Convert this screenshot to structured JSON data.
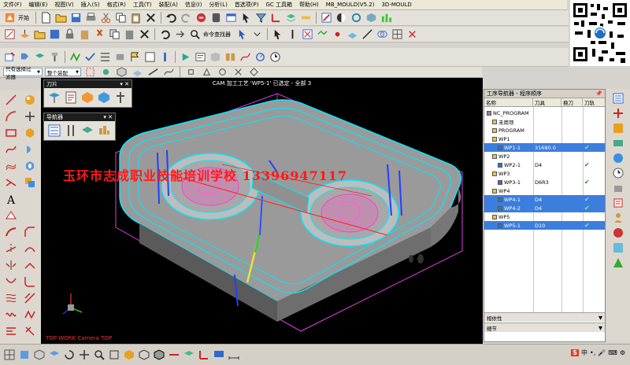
{
  "menu": [
    "文件(F)",
    "编辑(E)",
    "视图(V)",
    "插入(S)",
    "格式(R)",
    "工具(T)",
    "装配(A)",
    "信息(I)",
    "分析(L)",
    "首选项(P)",
    "GC 工具箱",
    "帮助(H)",
    "MB_MOULD(V5.2)",
    "3D-MOULD"
  ],
  "toolbar1": {
    "start_label": "开始"
  },
  "toolbar2": {
    "cmd_finder_label": "命令查找器"
  },
  "selection": {
    "filter_value": "只有选择过滤器",
    "assembly_value": "整个装配"
  },
  "camera_status": "CAM 加工工艺 'WP5-1' 已选定 - 全部 3",
  "watermark": "玉环市志成职业技能培训学校 13396947117",
  "view_label": "TOP WORK Camera TOP",
  "palettes": {
    "blade": "刀片",
    "navigator": "导航器"
  },
  "navigator": {
    "title": "工序导航器 - 程序顺序",
    "columns": [
      "名称",
      "刀具",
      "换刀",
      "刀轨"
    ],
    "rows": [
      {
        "name": "NC_PROGRAM",
        "tool": "",
        "check": "",
        "selected": false,
        "indent": 0,
        "icon": "program-icon"
      },
      {
        "name": "未用项",
        "tool": "",
        "check": "",
        "selected": false,
        "indent": 1,
        "icon": "folder-icon"
      },
      {
        "name": "PROGRAM",
        "tool": "",
        "check": "",
        "selected": false,
        "indent": 1,
        "icon": "folder-icon"
      },
      {
        "name": "WP1",
        "tool": "",
        "check": "",
        "selected": false,
        "indent": 1,
        "icon": "folder-icon"
      },
      {
        "name": "WP1-1",
        "tool": "31680.0",
        "check": "✔",
        "selected": true,
        "indent": 2,
        "icon": "operation-icon"
      },
      {
        "name": "WP2",
        "tool": "",
        "check": "",
        "selected": false,
        "indent": 1,
        "icon": "folder-icon"
      },
      {
        "name": "WP2-1",
        "tool": "D4",
        "check": "✔",
        "selected": false,
        "indent": 2,
        "icon": "operation-icon"
      },
      {
        "name": "WP3",
        "tool": "",
        "check": "",
        "selected": false,
        "indent": 1,
        "icon": "folder-icon"
      },
      {
        "name": "WP3-1",
        "tool": "D6R3",
        "check": "✔",
        "selected": false,
        "indent": 2,
        "icon": "operation-icon"
      },
      {
        "name": "WP4",
        "tool": "",
        "check": "",
        "selected": false,
        "indent": 1,
        "icon": "folder-icon"
      },
      {
        "name": "WP4-1",
        "tool": "D4",
        "check": "✔",
        "selected": true,
        "indent": 2,
        "icon": "operation-icon"
      },
      {
        "name": "WP4-2",
        "tool": "D4",
        "check": "✔",
        "selected": true,
        "indent": 2,
        "icon": "operation-icon"
      },
      {
        "name": "WP5",
        "tool": "",
        "check": "",
        "selected": false,
        "indent": 1,
        "icon": "folder-icon"
      },
      {
        "name": "WP5-1",
        "tool": "D10",
        "check": "✔",
        "selected": true,
        "indent": 2,
        "icon": "operation-icon"
      }
    ],
    "footer1": "相依性",
    "footer2": "细节"
  },
  "colors": {
    "accent": "#3c7ede",
    "toolpath": "#00e8ff",
    "part": "#8c8c8c",
    "highlight": "#ff3ccd"
  }
}
